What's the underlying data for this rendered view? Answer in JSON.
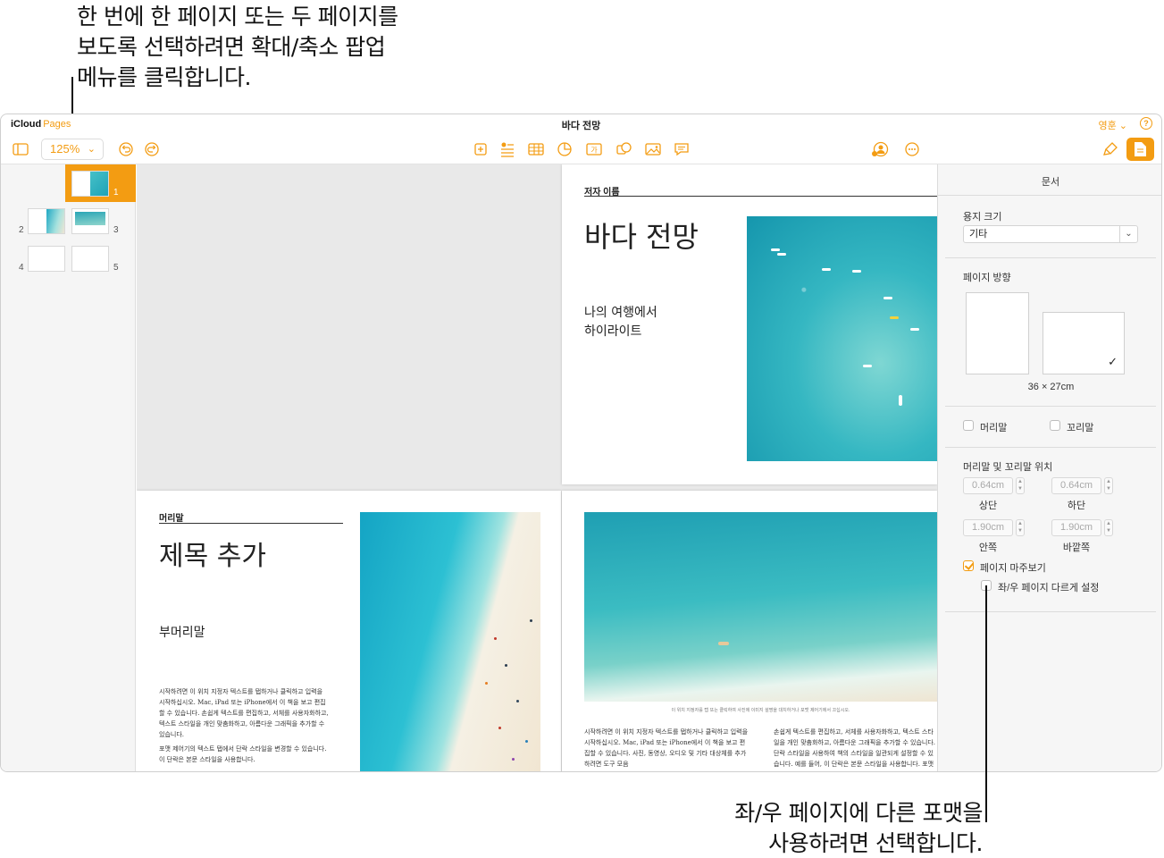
{
  "callouts": {
    "top": [
      "한 번에 한 페이지 또는 두 페이지를",
      "보도록 선택하려면 확대/축소 팝업",
      "메뉴를 클릭합니다."
    ],
    "bottom": [
      "좌/우 페이지에 다른 포맷을",
      "사용하려면 선택합니다."
    ]
  },
  "titlebar": {
    "brand": "iCloud",
    "product": "Pages",
    "doc_title": "바다 전망",
    "account": "영훈",
    "help": "?"
  },
  "toolbar": {
    "zoom_value": "125%"
  },
  "sidebar": {
    "page_numbers": [
      "1",
      "2",
      "3",
      "4",
      "5"
    ]
  },
  "pages": {
    "p1": {
      "author_label": "저자 이름",
      "title": "바다 전망",
      "subtitle_line1": "나의 여행에서",
      "subtitle_line2": "하이라이트"
    },
    "p2": {
      "header_label": "머리말",
      "title": "제목 추가",
      "subtitle": "부머리말",
      "body1": "시작하려면 이 위치 지정자 텍스트를 탭하거나 클릭하고 입력을 시작하십시오. Mac, iPad 또는 iPhone에서 이 책을 보고 편집할 수 있습니다. 손쉽게 텍스트를 편집하고, 서체를 사용자화하고, 텍스트 스타일을 개인 맞춤화하고, 아름다운 그래픽을 추가할 수 있습니다.",
      "body2": "포맷 제어기의 텍스트 탭에서 단락 스타일을 변경할 수 있습니다. 이 단락은 본문 스타일을 사용합니다."
    },
    "p3": {
      "caption": "이 위치 지정자를 탭 또는 클릭하여 사진에 이미지 설명을 대치하거나 포맷 제어기에서 끄십시오.",
      "col1": "시작하려면 이 위치 지정자 텍스트를 탭하거나 클릭하고 입력을 시작하십시오. Mac, iPad 또는 iPhone에서 이 책을 보고 편집할 수 있습니다. 사진, 동영상, 오디오 및 기타 대상체를 추가하려면 도구 모음",
      "col2": "손쉽게 텍스트를 편집하고, 서체를 사용자화하고, 텍스트 스타일을 개인 맞춤화하고, 아름다운 그래픽을 추가할 수 있습니다. 단락 스타일을 사용하여 책의 스타일을 일관되게 설정할 수 있습니다. 예를 들어, 이 단락은 본문 스타일을 사용합니다. 포맷 제어기의 텍스트 탭에서 변경할 수 있습니다."
    }
  },
  "inspector": {
    "title": "문서",
    "paper_size_label": "용지 크기",
    "paper_size_value": "기타",
    "orientation_label": "페이지 방향",
    "page_dims": "36 × 27cm",
    "header_checkbox": "머리말",
    "footer_checkbox": "꼬리말",
    "hf_position_label": "머리말 및 꼬리말 위치",
    "top_value": "0.64cm",
    "top_label": "상단",
    "bottom_value": "0.64cm",
    "bottom_label": "하단",
    "inside_value": "1.90cm",
    "inside_label": "안쪽",
    "outside_value": "1.90cm",
    "outside_label": "바깥쪽",
    "facing_pages": "페이지 마주보기",
    "different_lr": "좌/우 페이지 다르게 설정"
  },
  "colors": {
    "accent": "#f39c12"
  },
  "icons": [
    "sidebar-toggle-icon",
    "undo-icon",
    "redo-icon",
    "add-page-icon",
    "text-box-icon",
    "table-icon",
    "chart-icon",
    "text-icon",
    "shape-icon",
    "image-icon",
    "comment-icon",
    "collaborate-icon",
    "more-icon",
    "format-brush-icon",
    "document-icon"
  ]
}
